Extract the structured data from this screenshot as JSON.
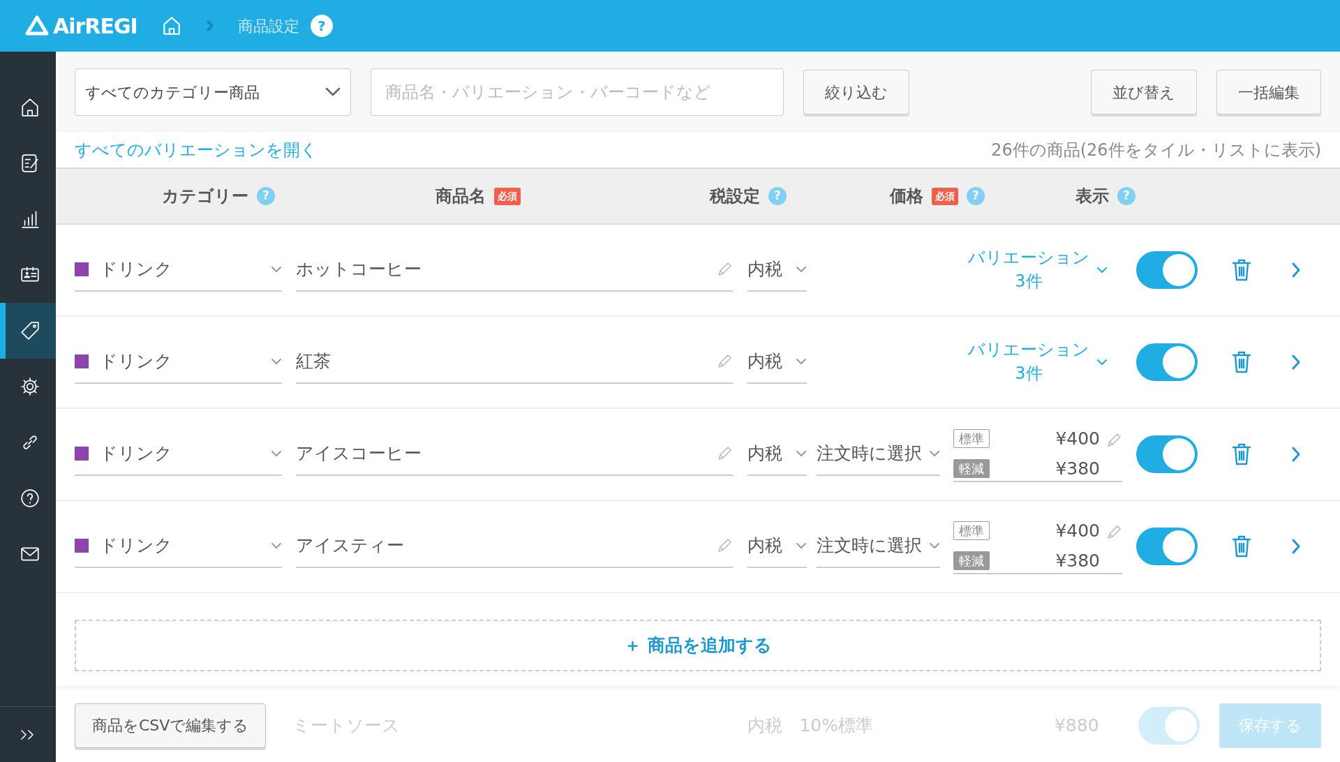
{
  "header": {
    "logo": "AirREGI",
    "breadcrumb": "商品設定",
    "help": "?"
  },
  "sidebar": {
    "items": [
      {
        "kind": "home",
        "selected": false
      },
      {
        "kind": "checklist",
        "selected": false
      },
      {
        "kind": "chart",
        "selected": false
      },
      {
        "kind": "card",
        "selected": false
      },
      {
        "kind": "tag",
        "selected": true
      },
      {
        "kind": "gear",
        "selected": false
      },
      {
        "kind": "link",
        "selected": false
      },
      {
        "kind": "help",
        "selected": false
      },
      {
        "kind": "mail",
        "selected": false
      }
    ]
  },
  "toolbar": {
    "category_select": "すべてのカテゴリー商品",
    "search": {
      "placeholder": "商品名・バリエーション・バーコードなど"
    },
    "filter_button": "絞り込む",
    "sort_button": "並び替え",
    "bulk_edit_button": "一括編集"
  },
  "expand_all_link": "すべてのバリエーションを開く",
  "summary": "26件の商品(26件をタイル・リストに表示)",
  "table": {
    "columns": [
      {
        "label": "カテゴリー",
        "help": "?"
      },
      {
        "label": "商品名",
        "required_label": "必須"
      },
      {
        "label": "税設定",
        "help": "?"
      },
      {
        "label": "価格",
        "required_label": "必須",
        "help": "?"
      },
      {
        "label": "表示",
        "help": "?"
      }
    ],
    "rows": [
      {
        "category": "ドリンク",
        "color": "#8e44ad",
        "name": "ホットコーヒー",
        "tax": "内税",
        "price": {
          "kind": "variations",
          "label": "バリエーション",
          "count": "3件"
        },
        "visible": true
      },
      {
        "category": "ドリンク",
        "color": "#8e44ad",
        "name": "紅茶",
        "tax": "内税",
        "price": {
          "kind": "variations",
          "label": "バリエーション",
          "count": "3件"
        },
        "visible": true
      },
      {
        "category": "ドリンク",
        "color": "#8e44ad",
        "name": "アイスコーヒー",
        "tax": "内税",
        "tax_rate": "注文時に選択",
        "price": {
          "kind": "prices",
          "items": [
            {
              "kind": "standard",
              "label": "標準",
              "value": "¥400"
            },
            {
              "kind": "reduced",
              "label": "軽減",
              "value": "¥380"
            }
          ]
        },
        "visible": true
      },
      {
        "category": "ドリンク",
        "color": "#8e44ad",
        "name": "アイスティー",
        "tax": "内税",
        "tax_rate": "注文時に選択",
        "price": {
          "kind": "prices",
          "items": [
            {
              "kind": "standard",
              "label": "標準",
              "value": "¥400"
            },
            {
              "kind": "reduced",
              "label": "軽減",
              "value": "¥380"
            }
          ]
        },
        "visible": true
      }
    ]
  },
  "add_product_button": "＋ 商品を追加する",
  "footer": {
    "csv_button": "商品をCSVで編集する",
    "save_button": "保存する",
    "background_row": {
      "name": "ミートソース",
      "tax": "内税",
      "tax_rate": "10%標準",
      "price": "¥880",
      "visible": true
    }
  }
}
